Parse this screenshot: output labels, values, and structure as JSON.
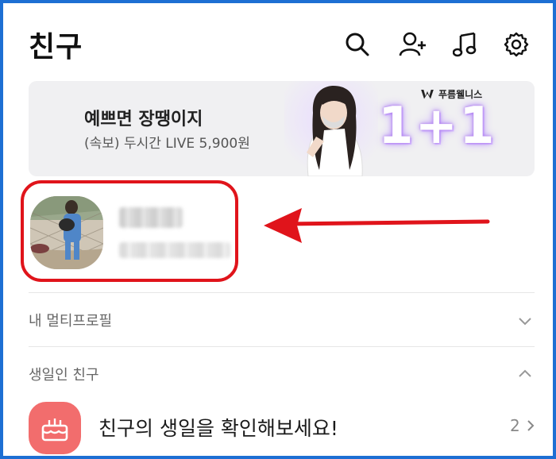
{
  "header": {
    "title": "친구",
    "icons": [
      "search-icon",
      "add-friend-icon",
      "music-icon",
      "settings-icon"
    ]
  },
  "banner": {
    "title": "예쁘면 장땡이지",
    "subtitle": "(속보) 두시간 LIVE 5,900원",
    "brand": "푸름웰니스",
    "promo": "1+1"
  },
  "profile": {
    "name": "",
    "status": ""
  },
  "sections": {
    "multiprofile_label": "내 멀티프로필",
    "birthday_label": "생일인 친구"
  },
  "birthday": {
    "text": "친구의 생일을 확인해보세요!",
    "count": "2"
  },
  "colors": {
    "frame": "#1d6fd3",
    "highlight": "#e0141b",
    "birthday_icon_bg": "#f26d6d"
  }
}
